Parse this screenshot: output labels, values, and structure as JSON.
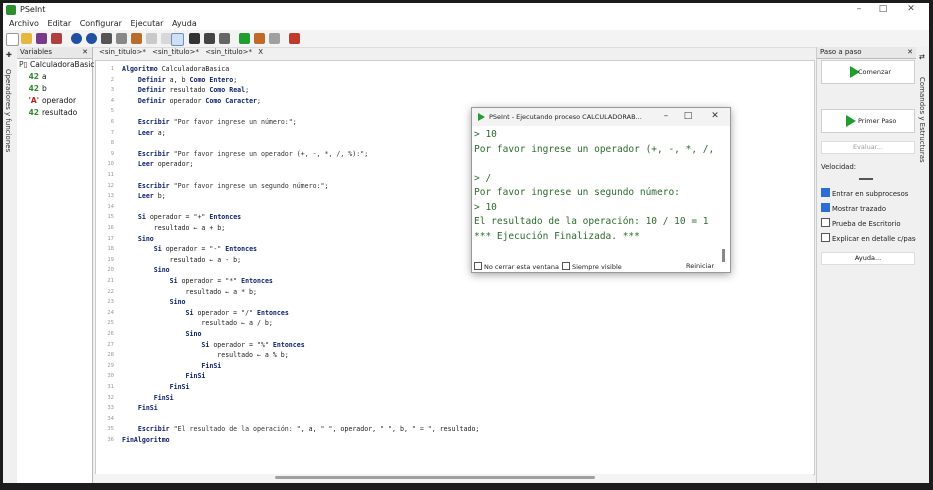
{
  "window": {
    "title": "PSeInt"
  },
  "menu": [
    "Archivo",
    "Editar",
    "Configurar",
    "Ejecutar",
    "Ayuda"
  ],
  "side_tab": "Operadores y funciones",
  "variables_panel": {
    "title": "Variables",
    "root": "CalculadoraBasic",
    "items": [
      {
        "type": "42",
        "name": "a"
      },
      {
        "type": "42",
        "name": "b"
      },
      {
        "type": "'A'",
        "name": "operador"
      },
      {
        "type": "42",
        "name": "resultado"
      }
    ]
  },
  "tabs": [
    "<sin_titulo>*",
    "<sin_titulo>*",
    "<sin_titulo>*"
  ],
  "tab_close": "X",
  "code": [
    {
      "n": "1",
      "t": "Algoritmo CalculadoraBasica"
    },
    {
      "n": "2",
      "t": "    Definir a, b Como Entero;"
    },
    {
      "n": "3",
      "t": "    Definir resultado Como Real;"
    },
    {
      "n": "4",
      "t": "    Definir operador Como Caracter;"
    },
    {
      "n": "5",
      "t": ""
    },
    {
      "n": "6",
      "t": "    Escribir \"Por favor ingrese un número:\";"
    },
    {
      "n": "7",
      "t": "    Leer a;"
    },
    {
      "n": "8",
      "t": ""
    },
    {
      "n": "9",
      "t": "    Escribir \"Por favor ingrese un operador (+, -, *, /, %):\";"
    },
    {
      "n": "10",
      "t": "    Leer operador;"
    },
    {
      "n": "11",
      "t": ""
    },
    {
      "n": "12",
      "t": "    Escribir \"Por favor ingrese un segundo número:\";"
    },
    {
      "n": "13",
      "t": "    Leer b;"
    },
    {
      "n": "14",
      "t": ""
    },
    {
      "n": "15",
      "t": "    Si operador = \"+\" Entonces"
    },
    {
      "n": "16",
      "t": "        resultado <- a + b;"
    },
    {
      "n": "17",
      "t": "    Sino"
    },
    {
      "n": "18",
      "t": "        Si operador = \"-\" Entonces"
    },
    {
      "n": "19",
      "t": "            resultado <- a - b;"
    },
    {
      "n": "20",
      "t": "        Sino"
    },
    {
      "n": "21",
      "t": "            Si operador = \"*\" Entonces"
    },
    {
      "n": "22",
      "t": "                resultado <- a * b;"
    },
    {
      "n": "23",
      "t": "            Sino"
    },
    {
      "n": "24",
      "t": "                Si operador = \"/\" Entonces"
    },
    {
      "n": "25",
      "t": "                    resultado <- a / b;"
    },
    {
      "n": "26",
      "t": "                Sino"
    },
    {
      "n": "27",
      "t": "                    Si operador = \"%\" Entonces"
    },
    {
      "n": "28",
      "t": "                        resultado <- a % b;"
    },
    {
      "n": "29",
      "t": "                    FinSi"
    },
    {
      "n": "30",
      "t": "                FinSi"
    },
    {
      "n": "31",
      "t": "            FinSi"
    },
    {
      "n": "32",
      "t": "        FinSi"
    },
    {
      "n": "33",
      "t": "    FinSi"
    },
    {
      "n": "34",
      "t": ""
    },
    {
      "n": "35",
      "t": "    Escribir \"El resultado de la operación: \", a, \" \", operador, \" \", b, \" = \", resultado;"
    },
    {
      "n": "36",
      "t": "FinAlgoritmo"
    }
  ],
  "right_panel": {
    "title": "Paso a paso",
    "start_label": "Comenzar",
    "first_step_label": "Primer Paso",
    "evaluate_label": "Evaluar...",
    "speed_label": "Velocidad:",
    "options": [
      {
        "label": "Entrar en subprocesos",
        "checked": true
      },
      {
        "label": "Mostrar trazado",
        "checked": true
      },
      {
        "label": "Prueba de Escritorio",
        "checked": false
      },
      {
        "label": "Explicar en detalle c/paso",
        "checked": false
      }
    ],
    "help_label": "Ayuda..."
  },
  "right_tab": "Comandos y Estructuras",
  "console_dialog": {
    "title": "PSeInt - Ejecutando proceso CALCULADORAB...",
    "lines": [
      "> 10",
      "Por favor ingrese un operador (+, -, *, /, %):",
      "",
      "> /",
      "Por favor ingrese un segundo número:",
      "> 10",
      "El resultado de la operación: 10 / 10 = 1",
      "*** Ejecución Finalizada. ***"
    ],
    "no_close_label": "No cerrar esta ventana",
    "always_visible_label": "Siempre visible",
    "restart_label": "Reiniciar"
  }
}
